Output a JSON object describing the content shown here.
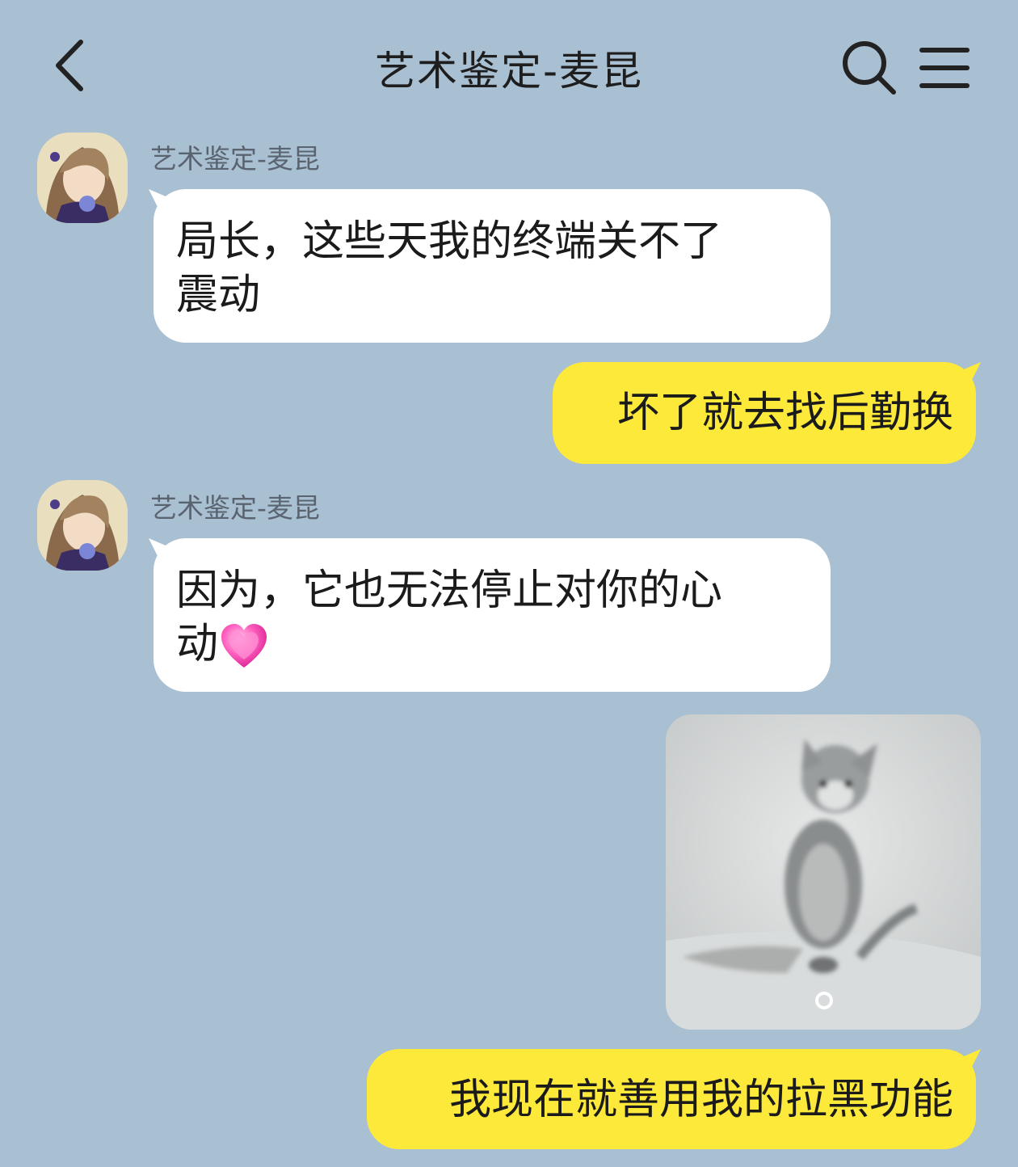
{
  "header": {
    "title": "艺术鉴定-麦昆",
    "icons": [
      "back-chevron-icon",
      "search-icon",
      "menu-icon"
    ]
  },
  "messages": [
    {
      "side": "left",
      "sender": "艺术鉴定-麦昆",
      "lines": [
        "局长，这些天我的终端关不了",
        "震动"
      ]
    },
    {
      "side": "right",
      "text": "坏了就去找后勤换"
    },
    {
      "side": "left",
      "sender": "艺术鉴定-麦昆",
      "lines": [
        "因为，它也无法停止对你的心",
        "动"
      ],
      "emoji": "pink-heart-icon"
    },
    {
      "side": "right",
      "type": "image",
      "image_icon": "cat-photo"
    },
    {
      "side": "right",
      "text": "我现在就善用我的拉黑功能"
    }
  ],
  "colors": {
    "background": "#a9bfd2",
    "incoming_bubble": "#ffffff",
    "outgoing_bubble": "#fde93a"
  }
}
